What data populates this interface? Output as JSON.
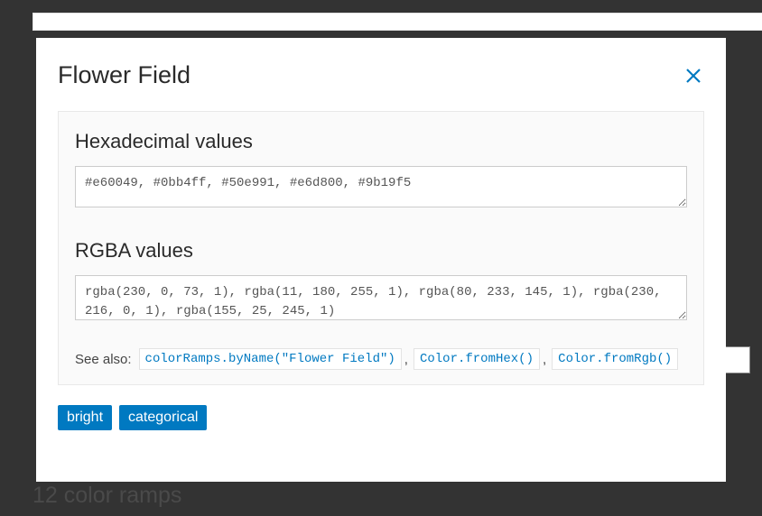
{
  "background": {
    "bottom_text": "12 color ramps"
  },
  "modal": {
    "title": "Flower Field",
    "panel": {
      "hex": {
        "title": "Hexadecimal values",
        "value": "#e60049, #0bb4ff, #50e991, #e6d800, #9b19f5"
      },
      "rgba": {
        "title": "RGBA values",
        "value": "rgba(230, 0, 73, 1), rgba(11, 180, 255, 1), rgba(80, 233, 145, 1), rgba(230, 216, 0, 1), rgba(155, 25, 245, 1)"
      },
      "see_also": {
        "label": "See also:",
        "links": [
          "colorRamps.byName(\"Flower Field\")",
          "Color.fromHex()",
          "Color.fromRgb()"
        ]
      }
    },
    "tags": [
      "bright",
      "categorical"
    ]
  }
}
